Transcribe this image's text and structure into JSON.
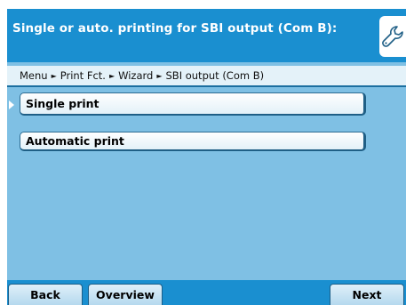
{
  "header": {
    "title": "Single or auto. printing for SBI output (Com B):",
    "icon": "wrench-icon"
  },
  "breadcrumb": {
    "items": [
      "Menu",
      "Print Fct.",
      "Wizard",
      "SBI output (Com B)"
    ],
    "separator": "►"
  },
  "menu": {
    "items": [
      {
        "label": "Single print",
        "selected": true
      },
      {
        "label": "Automatic print",
        "selected": false
      }
    ]
  },
  "footer": {
    "back_label": "Back",
    "overview_label": "Overview",
    "next_label": "Next"
  },
  "colors": {
    "header_blue": "#1a8fd0",
    "body_blue": "#7fc0e4",
    "breadcrumb_bg": "#e4f2f9"
  }
}
